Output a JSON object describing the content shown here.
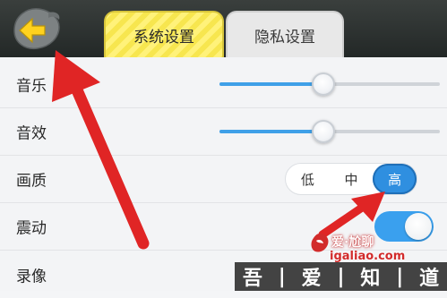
{
  "header": {
    "tabs": [
      {
        "label": "系统设置",
        "active": true
      },
      {
        "label": "隐私设置",
        "active": false
      }
    ]
  },
  "settings": {
    "music": {
      "label": "音乐",
      "level": 0.47
    },
    "sound": {
      "label": "音效",
      "level": 0.47
    },
    "quality": {
      "label": "画质",
      "options": [
        "低",
        "中",
        "高"
      ],
      "selected": "高"
    },
    "vibration": {
      "label": "震动",
      "on": true
    },
    "record": {
      "label": "录像"
    }
  },
  "watermark": {
    "top_text": "爱·尬聊",
    "url": "igaliao.com",
    "bottom_chars": [
      "吾",
      "|",
      "爱",
      "|",
      "知",
      "|",
      "道"
    ]
  },
  "colors": {
    "accent": "#2f8fe0",
    "arrow": "#e02525",
    "tab_active": "#f7e64f"
  },
  "icons": {
    "back": "arrow-left-icon"
  }
}
